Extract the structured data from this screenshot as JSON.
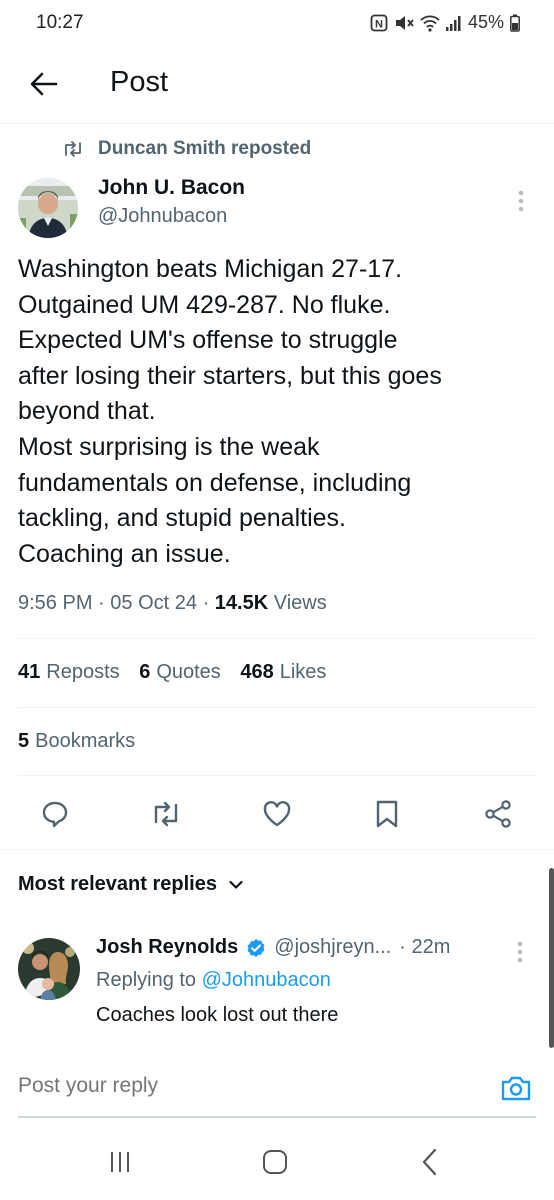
{
  "status_bar": {
    "time": "10:27",
    "battery": "45%",
    "icons": [
      "nfc-icon",
      "mute-icon",
      "wifi-icon",
      "signal-icon",
      "battery-icon"
    ]
  },
  "header": {
    "title": "Post",
    "back_icon": "arrow-left-icon"
  },
  "repost": {
    "icon": "repost-icon",
    "label": "Duncan Smith reposted"
  },
  "tweet": {
    "author_name": "John U. Bacon",
    "author_handle": "@Johnubacon",
    "lines": [
      "Washington beats Michigan 27-17.",
      "Outgained UM 429-287. No fluke.",
      "Expected UM's offense to struggle",
      "after losing their starters, but this goes",
      "beyond that.",
      "Most surprising is the weak",
      "fundamentals on defense, including",
      "tackling, and stupid penalties.",
      "Coaching an issue."
    ],
    "time": "9:56 PM",
    "date": "05 Oct 24",
    "views_count": "14.5K",
    "views_label": "Views",
    "separator": "·"
  },
  "stats": {
    "reposts_count": "41",
    "reposts_label": "Reposts",
    "quotes_count": "6",
    "quotes_label": "Quotes",
    "likes_count": "468",
    "likes_label": "Likes",
    "bookmarks_count": "5",
    "bookmarks_label": "Bookmarks"
  },
  "actions": [
    "reply-icon",
    "repost-icon",
    "like-icon",
    "bookmark-icon",
    "share-icon"
  ],
  "replies": {
    "sort_label": "Most relevant replies",
    "items": [
      {
        "name": "Josh Reynolds",
        "verified": true,
        "handle": "@joshjreyn...",
        "time": "· 22m",
        "replying_prefix": "Replying to",
        "replying_to": "@Johnubacon",
        "text": "Coaches look lost out there"
      }
    ]
  },
  "compose": {
    "placeholder": "Post your reply",
    "camera_icon": "camera-icon"
  },
  "colors": {
    "accent": "#1d9bf0",
    "text_primary": "#0f1419",
    "text_secondary": "#536471",
    "divider": "#eff3f4"
  },
  "nav_bar": [
    "recent-apps-icon",
    "home-icon",
    "back-icon"
  ]
}
